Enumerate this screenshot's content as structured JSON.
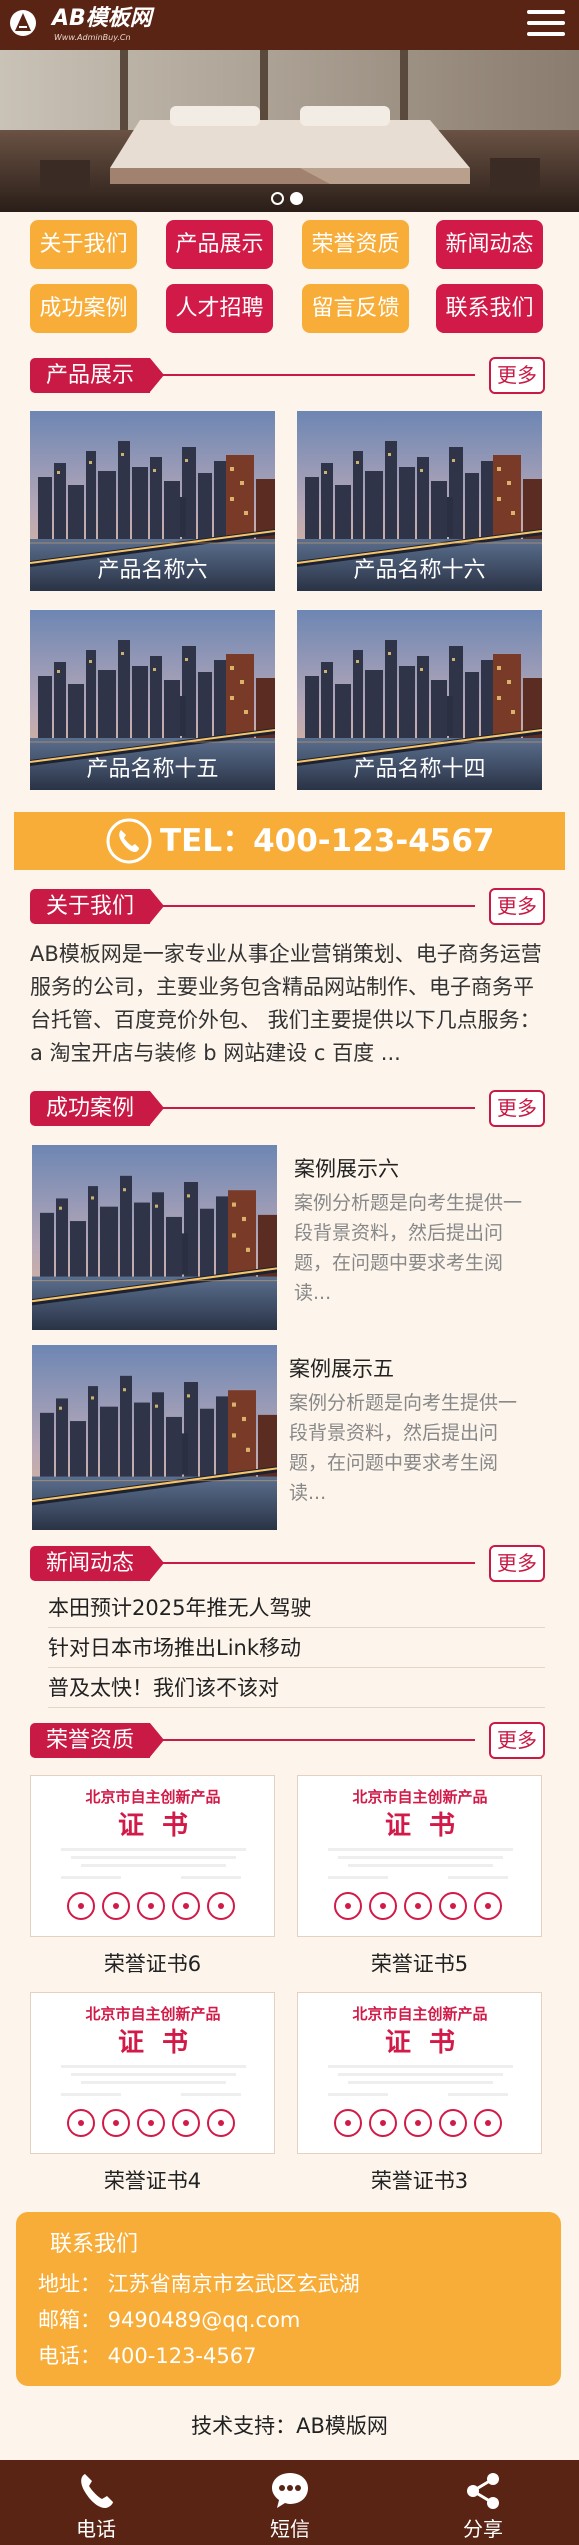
{
  "header": {
    "logo_text": "AB模板网",
    "logo_url": "Www.AdminBuy.Cn"
  },
  "nav": [
    {
      "label": "关于我们",
      "color": "#f8ad38"
    },
    {
      "label": "产品展示",
      "color": "#d11a48"
    },
    {
      "label": "荣誉资质",
      "color": "#f8ad38"
    },
    {
      "label": "新闻动态",
      "color": "#d11a48"
    },
    {
      "label": "成功案例",
      "color": "#f8ad38"
    },
    {
      "label": "人才招聘",
      "color": "#d11a48"
    },
    {
      "label": "留言反馈",
      "color": "#f8ad38"
    },
    {
      "label": "联系我们",
      "color": "#d11a48"
    }
  ],
  "more_label": "更多",
  "products": {
    "title": "产品展示",
    "items": [
      {
        "name": "产品名称六"
      },
      {
        "name": "产品名称十六"
      },
      {
        "name": "产品名称十五"
      },
      {
        "name": "产品名称十四"
      }
    ]
  },
  "phone_bar": {
    "text": "TEL：400-123-4567"
  },
  "about": {
    "title": "关于我们",
    "text": "AB模板网是一家专业从事企业营销策划、电子商务运营服务的公司，主要业务包含精品网站制作、电子商务平台托管、百度竞价外包、 我们主要提供以下几点服务： a 淘宝开店与装修 b 网站建设 c 百度 ..."
  },
  "cases": {
    "title": "成功案例",
    "items": [
      {
        "title": "案例展示六",
        "desc": "案例分析题是向考生提供一段背景资料，然后提出问题，在问题中要求考生阅读..."
      },
      {
        "title": "案例展示五",
        "desc": "案例分析题是向考生提供一段背景资料，然后提出问题，在问题中要求考生阅读..."
      }
    ]
  },
  "news": {
    "title": "新闻动态",
    "items": [
      "本田预计2025年推无人驾驶",
      "针对日本市场推出Link移动",
      "普及太快！我们该不该对"
    ]
  },
  "honors": {
    "title": "荣誉资质",
    "cert_title": "北京市自主创新产品",
    "cert_word": "证  书",
    "items": [
      {
        "name": "荣誉证书6"
      },
      {
        "name": "荣誉证书5"
      },
      {
        "name": "荣誉证书4"
      },
      {
        "name": "荣誉证书3"
      }
    ]
  },
  "contact": {
    "title": "联系我们",
    "address": "地址： 江苏省南京市玄武区玄武湖",
    "email": "邮箱： 9490489@qq.com",
    "phone": "电话： 400-123-4567"
  },
  "support": "技术支持：AB模版网",
  "footer": [
    {
      "label": "电话",
      "icon": "phone-icon"
    },
    {
      "label": "短信",
      "icon": "sms-icon"
    },
    {
      "label": "分享",
      "icon": "share-icon"
    }
  ],
  "colors": {
    "header_bg": "#5a2414",
    "accent_red": "#c81a45",
    "accent_orange": "#f8ad38",
    "page_bg": "#fdf5ec"
  }
}
